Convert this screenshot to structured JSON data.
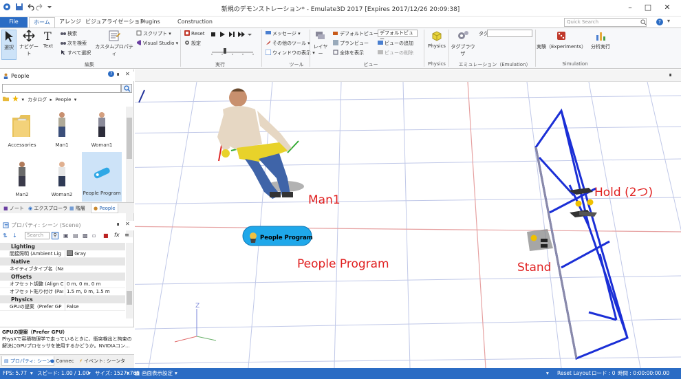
{
  "window": {
    "title": "新規のデモンストレーション* - Emulate3D 2017 [Expires 2017/12/26 20:09:38]"
  },
  "tabs": [
    {
      "label": "File"
    },
    {
      "label": "ホーム"
    },
    {
      "label": "アレンジ"
    },
    {
      "label": "ビジュアライゼーション"
    },
    {
      "label": "Plugins"
    },
    {
      "label": "Construction"
    }
  ],
  "quick_search_placeholder": "Quick Search",
  "ribbon": {
    "edit": {
      "select": "選択",
      "navigate": "ナビゲート",
      "text": "Text",
      "find": "検索",
      "find_next": "次を検索",
      "select_all": "すべて選択",
      "custom_property": "カスタムプロパティ",
      "script": "スクリプト",
      "visual_studio": "Visual Studio",
      "group": "編集"
    },
    "run": {
      "reset": "Reset",
      "settings": "設定",
      "group": "実行"
    },
    "tools": {
      "message": "メッセージ",
      "other_tools": "その他のツール",
      "window_view": "ウィンドウの表示",
      "group": "ツール"
    },
    "view": {
      "layer": "レイヤー",
      "default_view": "デフォルトビュー",
      "plan_view": "プランビュー",
      "fit_all": "全体を表示",
      "view_select": "デフォルトビュー",
      "add_view": "ビューの追加",
      "delete_view": "ビューの削除",
      "group": "ビュー"
    },
    "physics": {
      "label": "Physics",
      "group": "Physics"
    },
    "emulation": {
      "tag_browser": "タグブラウザ",
      "tag": "タグ",
      "group": "エミュレーション（Emulation）"
    },
    "simulation": {
      "experiments": "実験（Experiments）",
      "analysis": "分析実行",
      "group": "Simulation"
    }
  },
  "library": {
    "title": "People",
    "catalog_label": "カタログ",
    "catalog_value": "People",
    "items": [
      {
        "label": "Accessories"
      },
      {
        "label": "Man1"
      },
      {
        "label": "Woman1"
      },
      {
        "label": "Man2"
      },
      {
        "label": "Woman2"
      },
      {
        "label": "People Program"
      }
    ],
    "bottom_tabs": [
      "ノート",
      "エクスプローラ",
      "階層",
      "People"
    ]
  },
  "properties": {
    "title": "プロパティ: シーン (Scene)",
    "search_placeholder": "Search",
    "categories": [
      {
        "name": "Lighting",
        "rows": [
          {
            "name": "間接照明 (Ambient Lig",
            "value": "Gray"
          }
        ]
      },
      {
        "name": "Native",
        "rows": [
          {
            "name": "ネイティブタイプ名（Nati",
            "value": ""
          }
        ]
      },
      {
        "name": "Offsets",
        "rows": [
          {
            "name": "オフセット調整 (Align O",
            "value": "0 m, 0 m, 0 m"
          },
          {
            "name": "オフセット貼り付け (Paste",
            "value": "1.5 m, 0 m, 1.5 m"
          }
        ]
      },
      {
        "name": "Physics",
        "rows": [
          {
            "name": "GPUの提案（Prefer GP",
            "value": "False"
          }
        ]
      }
    ],
    "desc_title": "GPUの提案（Prefer GPU）",
    "desc_text": "PhysXで容積物理学で走っているときに、衝突検出と拘束の解決にGPUプロセッサを使用するかどうか。NVIDIAコン...",
    "bottom_tabs": [
      "プロパティ: シーン",
      "Connec",
      "イベント: シーン",
      "タ"
    ]
  },
  "viewport": {
    "program_badge": "People Program",
    "annotations": {
      "man1": "Man1",
      "people_program": "People Program",
      "stand": "Stand",
      "hold": "Hold (2つ)"
    },
    "axis_label": "Z"
  },
  "status": {
    "fps": "FPS: 5.77",
    "speed": "スピード: 1.00 / 1.00",
    "size": "サイズ: 1527x765",
    "screen_setting": "画面表示設定",
    "reset_layout": "Reset Layout",
    "load": "ロード : 0",
    "time": "時間 : 0:00:00:00.00"
  },
  "colors": {
    "accent": "#2b6cc4",
    "annotation": "#e02020",
    "structure": "#1b2fd6"
  }
}
